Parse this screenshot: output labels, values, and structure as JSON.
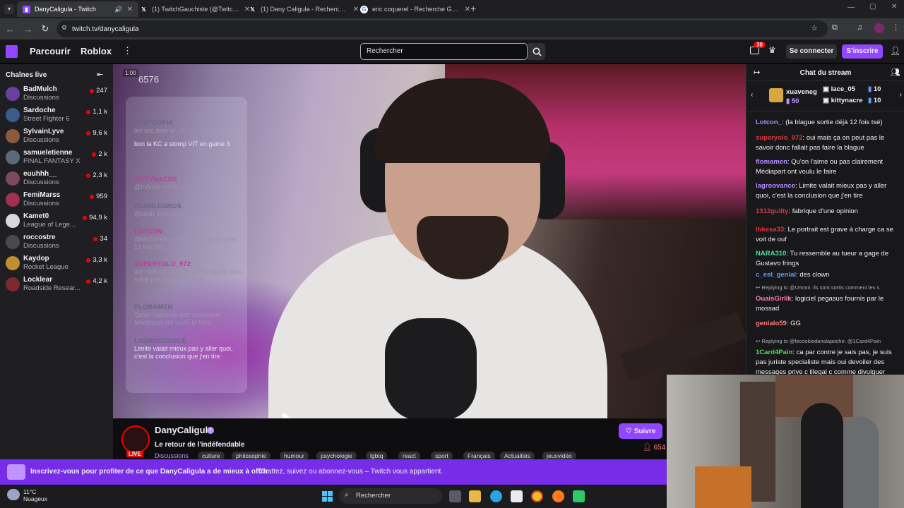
{
  "browser": {
    "tabs": [
      {
        "title": "DanyCaligula - Twitch",
        "active": true,
        "icon": "twitch-icon"
      },
      {
        "title": "(1) TwitchGauchiste (@TwitchG...",
        "active": false,
        "icon": "x-icon"
      },
      {
        "title": "(1) Dany Caligula - Recherche /...",
        "active": false,
        "icon": "x-icon"
      },
      {
        "title": "eric coquerel - Recherche Goog...",
        "active": false,
        "icon": "google-icon"
      }
    ],
    "url": "twitch.tv/danycaligula"
  },
  "topnav": {
    "browse": "Parcourir",
    "roblox": "Roblox",
    "search_placeholder": "Rechercher",
    "notif_count": "30",
    "login": "Se connecter",
    "signup": "S'inscrire"
  },
  "sidebar": {
    "title": "Chaînes live",
    "channels": [
      {
        "name": "BadMulch",
        "category": "Discussions",
        "viewers": "247",
        "color": "#6b3fa0"
      },
      {
        "name": "Sardoche",
        "category": "Street Fighter 6",
        "viewers": "1,1 k",
        "color": "#3a5c8a"
      },
      {
        "name": "SylvainLyve",
        "category": "Discussions",
        "viewers": "9,6 k",
        "color": "#8a5a3a"
      },
      {
        "name": "samueletienne",
        "category": "FINAL FANTASY X",
        "viewers": "2 k",
        "color": "#5a6a7a"
      },
      {
        "name": "euuhhh__",
        "category": "Discussions",
        "viewers": "2,3 k",
        "color": "#7a4a5a"
      },
      {
        "name": "FemiMarss",
        "category": "Discussions",
        "viewers": "959",
        "color": "#a03050"
      },
      {
        "name": "Kamet0",
        "category": "League of Lege...",
        "viewers": "94,9 k",
        "color": "#d8d8d8"
      },
      {
        "name": "roccostre",
        "category": "Discussions",
        "viewers": "34",
        "color": "#4a4a4a"
      },
      {
        "name": "Kaydop",
        "category": "Rocket League",
        "viewers": "3,3 k",
        "color": "#c09030"
      },
      {
        "name": "Locklear",
        "category": "Roadside Resear...",
        "viewers": "4,2 k",
        "color": "#7a2a2a"
      }
    ]
  },
  "video": {
    "timer": "1:00",
    "count": "6576",
    "overlay": [
      {
        "name": "DYSTOOPIK",
        "text": "les soc dem un pb"
      },
      {
        "name": "",
        "text": "bon la KC a stomp VIT en game 3"
      },
      {
        "name": "KITTYNACRE",
        "text": "@InArtus oui tqt c bon"
      },
      {
        "name": "ZDAMLEGROS",
        "text": "@souh_bhls 100%"
      },
      {
        "name": "LOTCON_",
        "text": "@McCuredent (la blague sortie déjà 12 fois tsé)"
      },
      {
        "name": "SUPERYOLO_972",
        "text": "oui mais ça on peut pas le savoir donc fallait pas faire la blague"
      },
      {
        "name": "FLOMAMEN",
        "text": "Qu'on l'aime ou pas clairement Médiapart ont voulu le faire"
      },
      {
        "name": "LAGROOVANCE",
        "text": "Limite valait mieux pas y aller quoi, c'est la conclusion que j'en tire"
      }
    ]
  },
  "info": {
    "live": "LIVE",
    "name": "DanyCaligula",
    "title": "Le retour de l'indéfendable",
    "category": "Discussions",
    "tags": [
      "culture",
      "philosophie",
      "humour",
      "psychologie",
      "lgbtq",
      "react",
      "sport",
      "Français",
      "Actualités",
      "jeuxvidéo"
    ],
    "follow": "Suivre",
    "viewers": "654"
  },
  "chat": {
    "title": "Chat du stream",
    "gifts": [
      {
        "name": "xuaveneg",
        "count": "50"
      },
      {
        "name": "lace_05",
        "count": "10"
      },
      {
        "name": "kittynacre",
        "count": "10"
      }
    ],
    "messages": [
      {
        "user": "Lotcon_",
        "color": "#b38bff",
        "text": "(la blague sortie déjà 12 fois tsé)"
      },
      {
        "user": "superyolo_972",
        "color": "#d43c3c",
        "text": "oui mais ça on peut pas le savoir donc fallait pas faire la blague"
      },
      {
        "user": "flomamen",
        "color": "#b38bff",
        "text": "Qu'on l'aime ou pas clairement Médiapart ont voulu le faire"
      },
      {
        "user": "lagroovance",
        "color": "#b38bff",
        "text": "Limite valait mieux pas y aller quoi, c'est la conclusion que j'en tire"
      },
      {
        "user": "1312guilty",
        "color": "#d43c3c",
        "text": "fabrique d'une opinion"
      },
      {
        "user": "lbkesa33",
        "color": "#d43c3c",
        "text": "Le portrait est grave à charge ca se voit de ouf"
      },
      {
        "user": "NARA310",
        "color": "#4ce0a0",
        "text": "Tu ressemble au tueur a gage de Gustavo frings"
      },
      {
        "user": "c_est_genial",
        "color": "#5c9cff",
        "text": "des clown"
      },
      {
        "user": "OuaisGirlik",
        "color": "#ff7eb0",
        "text": "logiciel pegasus fournis par le mossad",
        "reply": "Replying to @Umnni: ils sont sortis comment les s"
      },
      {
        "user": "genialo59",
        "color": "#ff7e7e",
        "text": "GG"
      },
      {
        "user": "1Card4Pain",
        "color": "#4ce04c",
        "text": "ca par contre je sais pas, je suis pas juriste specialiste mais oui devoiler des messages prive c illegal c comme divulguer",
        "reply": "Replying to @lecookiedanslapoche: @1Card4Pain"
      }
    ]
  },
  "banner": {
    "text": "Inscrivez-vous pour profiter de ce que DanyCaligula a de mieux à offrir",
    "text2": "Chattez, suivez ou abonnez-vous – Twitch vous appartient."
  },
  "taskbar": {
    "temp": "11°C",
    "weather": "Nuageux",
    "search": "Rechercher"
  },
  "colors": {
    "twitch_purple": "#9147ff",
    "live_red": "#eb0400"
  }
}
